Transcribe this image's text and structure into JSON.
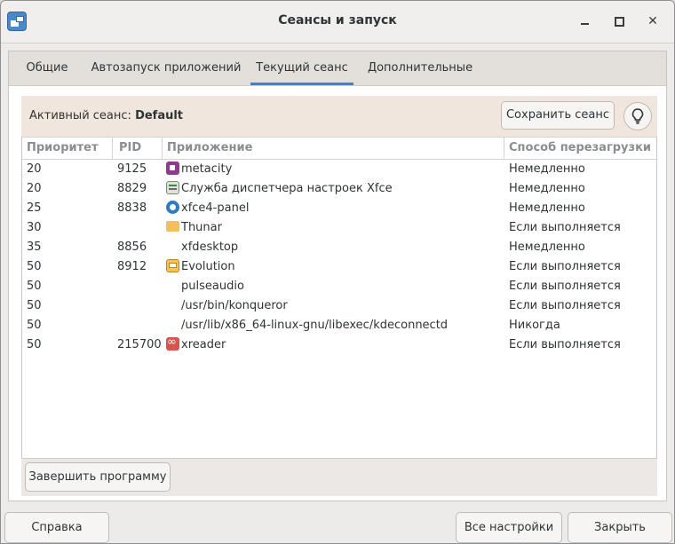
{
  "window": {
    "title": "Сеансы и запуск"
  },
  "tabs": [
    {
      "label": "Общие"
    },
    {
      "label": "Автозапуск приложений"
    },
    {
      "label": "Текущий сеанс"
    },
    {
      "label": "Дополнительные"
    }
  ],
  "active_tab": "Текущий сеанс",
  "session": {
    "label": "Активный сеанс:",
    "name": "Default",
    "save_button": "Сохранить сеанс"
  },
  "table": {
    "columns": [
      "Приоритет",
      "PID",
      "Приложение",
      "Способ перезагрузки"
    ],
    "rows": [
      {
        "priority": "20",
        "pid": "9125",
        "app": "metacity",
        "icon": "metacity-icon",
        "restart": "Немедленно"
      },
      {
        "priority": "20",
        "pid": "8829",
        "app": "Служба диспетчера настроек Xfce",
        "icon": "settings-manager-icon",
        "restart": "Немедленно"
      },
      {
        "priority": "25",
        "pid": "8838",
        "app": "xfce4-panel",
        "icon": "panel-icon",
        "restart": "Немедленно"
      },
      {
        "priority": "30",
        "pid": "",
        "app": "Thunar",
        "icon": "folder-icon",
        "restart": "Если выполняется"
      },
      {
        "priority": "35",
        "pid": "8856",
        "app": "xfdesktop",
        "icon": "",
        "restart": "Немедленно"
      },
      {
        "priority": "50",
        "pid": "8912",
        "app": "Evolution",
        "icon": "evolution-icon",
        "restart": "Если выполняется"
      },
      {
        "priority": "50",
        "pid": "",
        "app": "pulseaudio",
        "icon": "",
        "restart": "Если выполняется"
      },
      {
        "priority": "50",
        "pid": "",
        "app": "/usr/bin/konqueror",
        "icon": "",
        "restart": "Если выполняется"
      },
      {
        "priority": "50",
        "pid": "",
        "app": "/usr/lib/x86_64-linux-gnu/libexec/kdeconnectd",
        "icon": "",
        "restart": "Никогда"
      },
      {
        "priority": "50",
        "pid": "215700",
        "app": "xreader",
        "icon": "xreader-icon",
        "restart": "Если выполняется"
      }
    ]
  },
  "kill_button": "Завершить программу",
  "footer": {
    "help": "Справка",
    "all_settings": "Все настройки",
    "close": "Закрыть"
  },
  "colors": {
    "accent": "#3584e4",
    "session_bar": "#f1e6dd"
  }
}
